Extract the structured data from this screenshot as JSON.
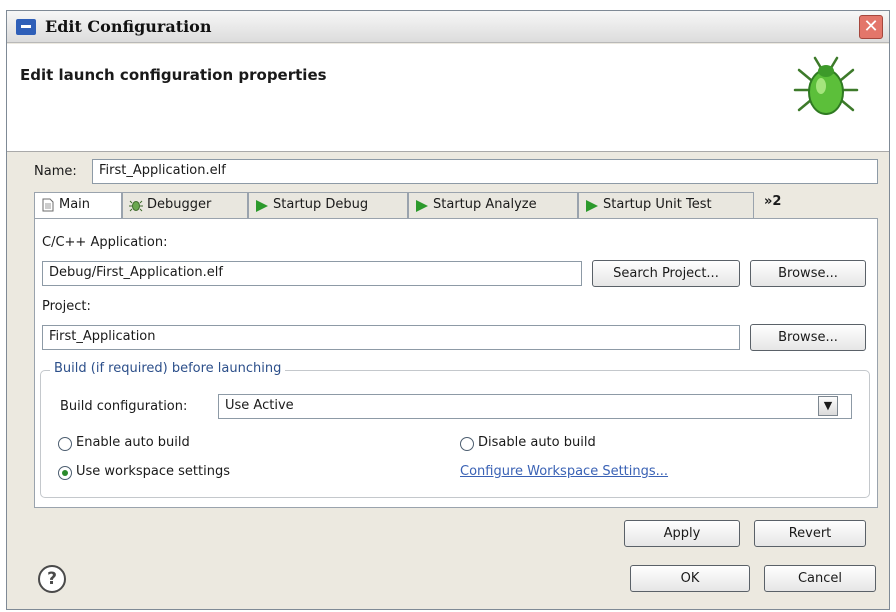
{
  "window": {
    "title": "Edit Configuration",
    "close_glyph": "✕"
  },
  "banner": {
    "title": "Edit launch configuration properties",
    "icon": "debug-bug-icon"
  },
  "name_field": {
    "label": "Name:",
    "value": "First_Application.elf"
  },
  "tabs": [
    {
      "label": "Main",
      "icon": "document-icon",
      "active": true
    },
    {
      "label": "Debugger",
      "icon": "bug-icon",
      "active": false
    },
    {
      "label": "Startup Debug",
      "icon": "play-icon",
      "active": false
    },
    {
      "label": "Startup Analyze",
      "icon": "play-icon",
      "active": false
    },
    {
      "label": "Startup Unit Test",
      "icon": "play-icon",
      "active": false
    }
  ],
  "tab_overflow": "»2",
  "main": {
    "app_label": "C/C++ Application:",
    "app_value": "Debug/First_Application.elf",
    "search_project_label": "Search Project...",
    "browse_label": "Browse...",
    "project_label": "Project:",
    "project_value": "First_Application",
    "project_browse_label": "Browse..."
  },
  "build": {
    "group_label": "Build (if required) before launching",
    "config_label": "Build configuration:",
    "config_value": "Use Active",
    "enable_auto_build": "Enable auto build",
    "disable_auto_build": "Disable auto build",
    "use_workspace": "Use workspace settings",
    "configure_link": "Configure Workspace Settings...",
    "selected": "use_workspace"
  },
  "buttons": {
    "apply": "Apply",
    "revert": "Revert",
    "ok": "OK",
    "cancel": "Cancel"
  },
  "help_glyph": "?",
  "colors": {
    "accent_green": "#2c9a2c",
    "link_blue": "#3a62b5",
    "group_label": "#2c4f8a"
  }
}
